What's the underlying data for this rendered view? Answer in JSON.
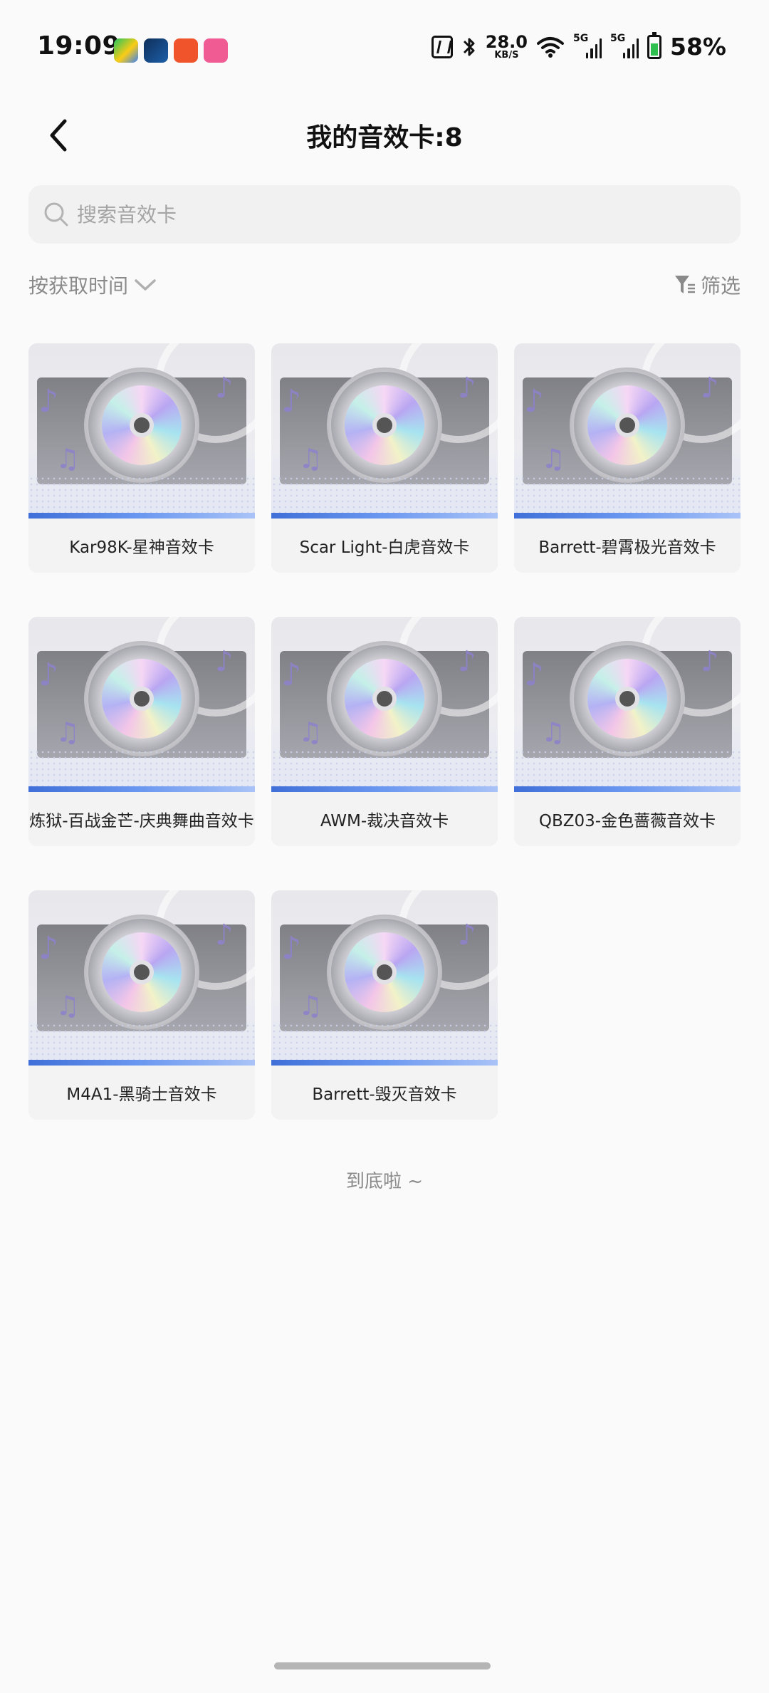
{
  "status_bar": {
    "time": "19:09",
    "app_icons": [
      "video-app-icon",
      "game-app-icon",
      "kuaishou-app-icon",
      "pink-app-icon"
    ],
    "net_speed": "28.0",
    "net_speed_unit": "KB/S",
    "signal_label_1": "5G",
    "signal_label_2": "5G",
    "battery_percent": "58%",
    "battery_level": 0.58
  },
  "header": {
    "title": "我的音效卡:8"
  },
  "search": {
    "placeholder": "搜索音效卡",
    "value": ""
  },
  "sort": {
    "label": "按获取时间"
  },
  "filter": {
    "label": "筛选"
  },
  "cards": [
    {
      "label": "Kar98K-星神音效卡"
    },
    {
      "label": "Scar Light-白虎音效卡"
    },
    {
      "label": "Barrett-碧霄极光音效卡"
    },
    {
      "label": "炼狱-百战金芒-庆典舞曲音效卡"
    },
    {
      "label": "AWM-裁决音效卡"
    },
    {
      "label": "QBZ03-金色蔷薇音效卡"
    },
    {
      "label": "M4A1-黑骑士音效卡"
    },
    {
      "label": "Barrett-毁灭音效卡"
    }
  ],
  "end_text": "到底啦 ~",
  "colors": {
    "background": "#fafafa",
    "search_bg": "#f1f1f1",
    "card_bg": "#f3f3f3",
    "muted_text": "#8a8a8a",
    "accent_blue": "#3f6fd8",
    "battery_green": "#2fbf4f"
  }
}
